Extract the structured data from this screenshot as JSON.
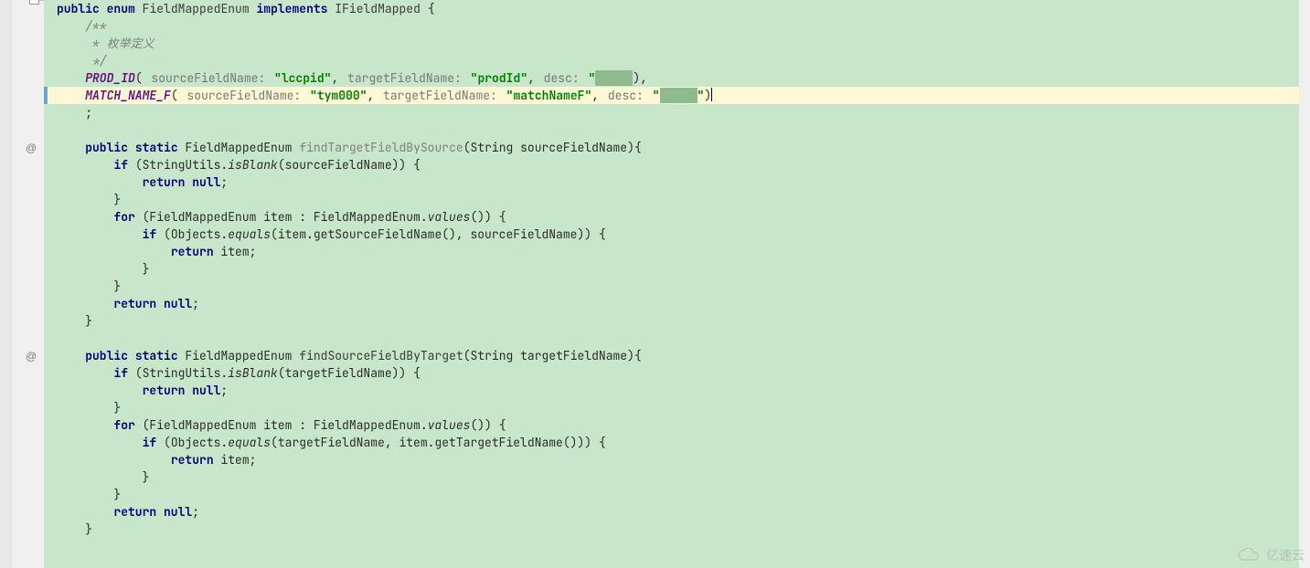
{
  "watermark_text": "亿速云",
  "gutter": {
    "fold_top_char": "−",
    "at1": "@",
    "at2": "@"
  },
  "code": {
    "l00a": "/**",
    "l00b": "*/",
    "l01_kw1": "public",
    "l01_kw2": "enum",
    "l01_name": "FieldMappedEnum",
    "l01_kw3": "implements",
    "l01_iface": "IFieldMapped",
    "l01_tail": " {",
    "l02": "/**",
    "l03": " * 枚举定义",
    "l04": " */",
    "l05_id": "PROD_ID",
    "l05_open": "(",
    "l05_h1": " sourceFieldName: ",
    "l05_s1": "\"lccpid\"",
    "l05_h2": " targetFieldName: ",
    "l05_s2": "\"prodId\"",
    "l05_h3": " desc: ",
    "l05_s3a": "\"",
    "l05_sel": "     ",
    "l05_tail": "),",
    "l06_id": "MATCH_NAME_F",
    "l06_open": "(",
    "l06_h1": " sourceFieldName: ",
    "l06_s1": "\"tym000\"",
    "l06_h2": " targetFieldName: ",
    "l06_s2": "\"matchNameF\"",
    "l06_h3": " desc: ",
    "l06_s3a": "\"",
    "l06_sel": "     ",
    "l06_s3b": "\"",
    "l06_tail": ")",
    "l07": ";",
    "l09_kw1": "public",
    "l09_kw2": "static",
    "l09_type": "FieldMappedEnum",
    "l09_name": "findTargetFieldBySource",
    "l09_params": "(String sourceFieldName){",
    "l10_kw": "if",
    "l10_a": " (StringUtils.",
    "l10_call": "isBlank",
    "l10_b": "(sourceFieldName)) {",
    "l11_kw": "return null",
    "l11_tail": ";",
    "l12": "}",
    "l13_kw": "for",
    "l13_a": " (FieldMappedEnum item : FieldMappedEnum.",
    "l13_call": "values",
    "l13_b": "()) {",
    "l14_kw": "if",
    "l14_a": " (Objects.",
    "l14_call": "equals",
    "l14_b": "(item.getSourceFieldName(), sourceFieldName)) {",
    "l15_kw": "return",
    "l15_b": " item;",
    "l16": "}",
    "l17": "}",
    "l18_kw": "return null",
    "l18_tail": ";",
    "l19": "}",
    "l21_kw1": "public",
    "l21_kw2": "static",
    "l21_type": "FieldMappedEnum",
    "l21_name": "findSourceFieldByTarget",
    "l21_params": "(String targetFieldName){",
    "l22_kw": "if",
    "l22_a": " (StringUtils.",
    "l22_call": "isBlank",
    "l22_b": "(targetFieldName)) {",
    "l23_kw": "return null",
    "l23_tail": ";",
    "l24": "}",
    "l25_kw": "for",
    "l25_a": " (FieldMappedEnum item : FieldMappedEnum.",
    "l25_call": "values",
    "l25_b": "()) {",
    "l26_kw": "if",
    "l26_a": " (Objects.",
    "l26_call": "equals",
    "l26_b": "(targetFieldName, item.getTargetFieldName())) {",
    "l27_kw": "return",
    "l27_b": " item;",
    "l28": "}",
    "l29": "}",
    "l30_kw": "return null",
    "l30_tail": ";",
    "l31": "}"
  }
}
